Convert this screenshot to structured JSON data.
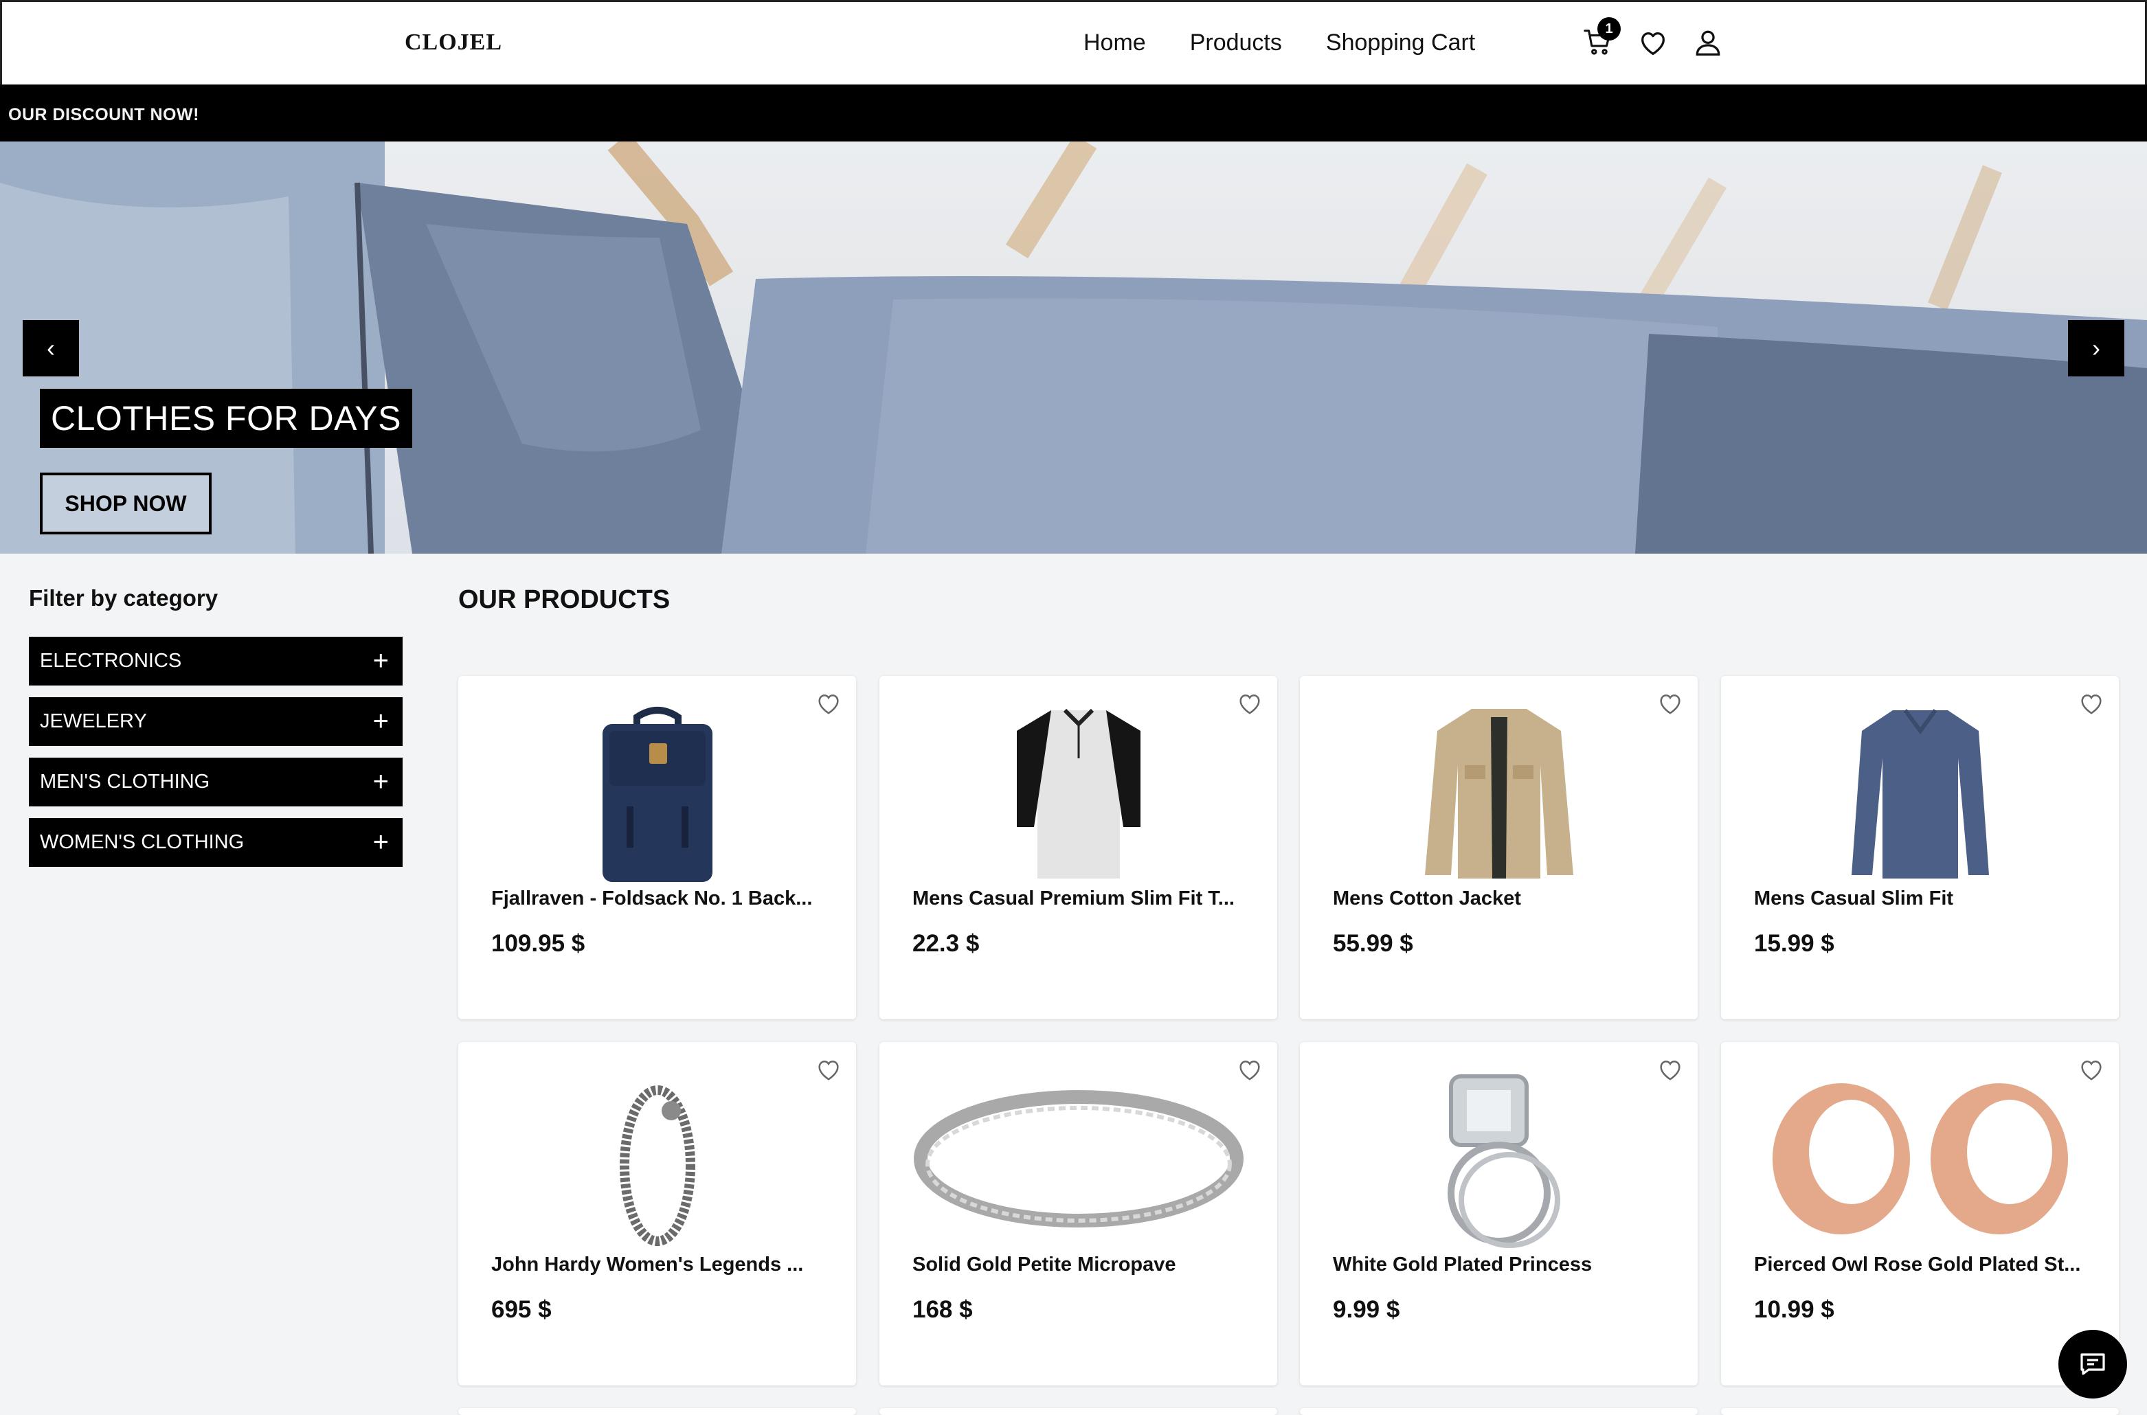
{
  "header": {
    "logo": "CLOJEL",
    "nav": [
      "Home",
      "Products",
      "Shopping Cart"
    ],
    "cart_count": "1",
    "icons": [
      "cart-icon",
      "heart-icon",
      "user-icon"
    ]
  },
  "promo": {
    "text": "OUR DISCOUNT NOW!"
  },
  "hero": {
    "title": "CLOTHES FOR DAYS",
    "cta": "SHOP NOW",
    "prev": "‹",
    "next": "›"
  },
  "sidebar": {
    "title": "Filter by category",
    "categories": [
      "ELECTRONICS",
      "JEWELERY",
      "MEN'S CLOTHING",
      "WOMEN'S CLOTHING"
    ]
  },
  "products": {
    "title": "OUR PRODUCTS",
    "items": [
      {
        "title": "Fjallraven - Foldsack No. 1 Back...",
        "price": "109.95 $",
        "image": "backpack"
      },
      {
        "title": "Mens Casual Premium Slim Fit T...",
        "price": "22.3 $",
        "image": "tshirt"
      },
      {
        "title": "Mens Cotton Jacket",
        "price": "55.99 $",
        "image": "jacket"
      },
      {
        "title": "Mens Casual Slim Fit",
        "price": "15.99 $",
        "image": "longsleeve"
      },
      {
        "title": "John Hardy Women's Legends ...",
        "price": "695 $",
        "image": "bracelet"
      },
      {
        "title": "Solid Gold Petite Micropave",
        "price": "168 $",
        "image": "band-ring"
      },
      {
        "title": "White Gold Plated Princess",
        "price": "9.99 $",
        "image": "princess-ring"
      },
      {
        "title": "Pierced Owl Rose Gold Plated St...",
        "price": "10.99 $",
        "image": "tunnel-plugs"
      }
    ]
  },
  "colors": {
    "accent": "#000000",
    "background": "#f2f4f6",
    "card": "#ffffff"
  }
}
